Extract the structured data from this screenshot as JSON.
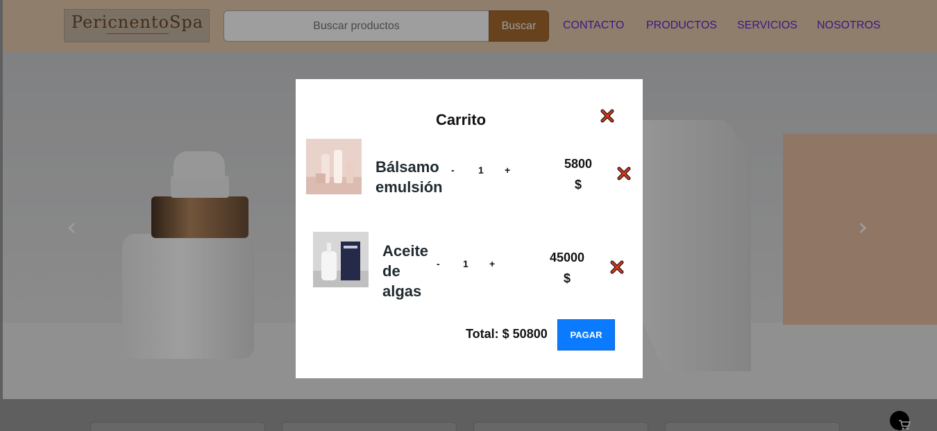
{
  "header": {
    "logo_text": "PericnentoSpa",
    "search": {
      "placeholder": "Buscar productos",
      "button_label": "Buscar"
    },
    "nav": [
      "CONTACTO",
      "PRODUCTOS",
      "SERVICIOS",
      "NOSOTROS"
    ]
  },
  "carousel": {
    "prev_icon": "‹",
    "next_icon": "›"
  },
  "cart": {
    "title": "Carrito",
    "items": [
      {
        "name_lines": [
          "Bálsamo",
          "emulsión"
        ],
        "qty": "1",
        "minus": "-",
        "plus": "+",
        "price": "5800",
        "currency": "$"
      },
      {
        "name_lines": [
          "Aceite",
          "de",
          "algas"
        ],
        "qty": "1",
        "minus": "-",
        "plus": "+",
        "price": "45000",
        "currency": "$"
      }
    ],
    "total_label": "Total: $ 50800",
    "pay_label": "PAGAR"
  },
  "colors": {
    "header_bg": "#e9ccaf",
    "search_button": "#a66b30",
    "nav_link": "#5a2ad0",
    "pay_button": "#0a7bff",
    "close_icon": "#d23a1f"
  }
}
